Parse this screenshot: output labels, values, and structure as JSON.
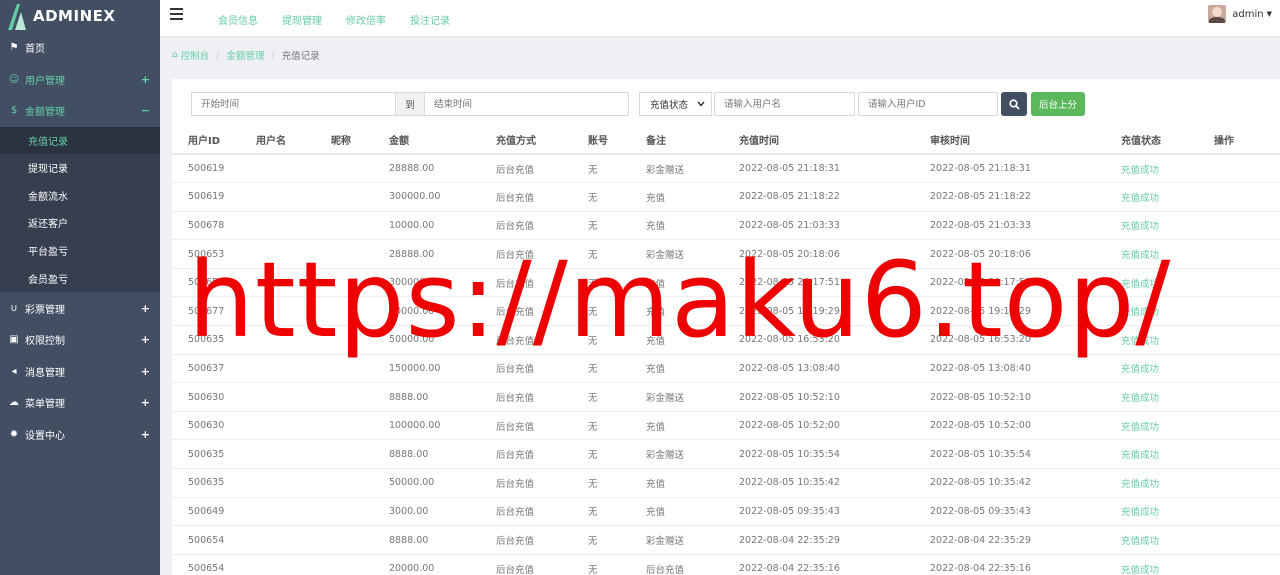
{
  "brand": {
    "name": "ADMINEX"
  },
  "sidebar": {
    "items": [
      {
        "key": "home",
        "label": "首页",
        "icon": "flag-icon",
        "toggle": ""
      },
      {
        "key": "users",
        "label": "用户管理",
        "icon": "smile-icon",
        "toggle": "+"
      },
      {
        "key": "finance",
        "label": "金额管理",
        "icon": "dollar-icon",
        "toggle": "−"
      }
    ],
    "subitems": [
      {
        "label": "充值记录",
        "active": true
      },
      {
        "label": "提现记录"
      },
      {
        "label": "金额流水"
      },
      {
        "label": "返还客户"
      },
      {
        "label": "平台盈亏"
      },
      {
        "label": "会员盈亏"
      }
    ],
    "items_after": [
      {
        "key": "lottery",
        "label": "彩票管理",
        "icon": "magnet-icon",
        "toggle": "+"
      },
      {
        "key": "permissions",
        "label": "权限控制",
        "icon": "lock-icon",
        "toggle": "+"
      },
      {
        "key": "messages",
        "label": "消息管理",
        "icon": "bullhorn-icon",
        "toggle": "+"
      },
      {
        "key": "menus",
        "label": "菜单管理",
        "icon": "cloud-icon",
        "toggle": "+"
      },
      {
        "key": "settings",
        "label": "设置中心",
        "icon": "gear-icon",
        "toggle": "+"
      }
    ]
  },
  "header": {
    "nav": [
      "会员信息",
      "提现管理",
      "修改倍率",
      "投注记录"
    ],
    "user": "admin"
  },
  "breadcrumb": {
    "home": "控制台",
    "parent": "金额管理",
    "current": "充值记录"
  },
  "filters": {
    "start_placeholder": "开始时间",
    "to_label": "到",
    "end_placeholder": "结束时间",
    "status_select": "充值状态",
    "username_placeholder": "请输入用户名",
    "userid_placeholder": "请输入用户ID",
    "add_button": "后台上分"
  },
  "table": {
    "columns": [
      "用户ID",
      "用户名",
      "昵称",
      "金额",
      "充值方式",
      "账号",
      "备注",
      "充值时间",
      "审核时间",
      "充值状态",
      "操作"
    ],
    "rows": [
      [
        "500619",
        "",
        "",
        "28888.00",
        "后台充值",
        "无",
        "彩金赠送",
        "2022-08-05 21:18:31",
        "2022-08-05 21:18:31",
        "充值成功",
        ""
      ],
      [
        "500619",
        "",
        "",
        "300000.00",
        "后台充值",
        "无",
        "充值",
        "2022-08-05 21:18:22",
        "2022-08-05 21:18:22",
        "充值成功",
        ""
      ],
      [
        "500678",
        "",
        "",
        "10000.00",
        "后台充值",
        "无",
        "充值",
        "2022-08-05 21:03:33",
        "2022-08-05 21:03:33",
        "充值成功",
        ""
      ],
      [
        "500653",
        "",
        "",
        "28888.00",
        "后台充值",
        "无",
        "彩金赠送",
        "2022-08-05 20:18:06",
        "2022-08-05 20:18:06",
        "充值成功",
        ""
      ],
      [
        "500653",
        "",
        "",
        "300000.00",
        "后台充值",
        "无",
        "充值",
        "2022-08-05 20:17:51",
        "2022-08-05 20:17:51",
        "充值成功",
        ""
      ],
      [
        "500677",
        "",
        "",
        "10000.00",
        "后台充值",
        "无",
        "充值",
        "2022-08-05 19:19:29",
        "2022-08-05 19:19:29",
        "充值成功",
        ""
      ],
      [
        "500635",
        "",
        "",
        "50000.00",
        "后台充值",
        "无",
        "充值",
        "2022-08-05 16:53:20",
        "2022-08-05 16:53:20",
        "充值成功",
        ""
      ],
      [
        "500637",
        "",
        "",
        "150000.00",
        "后台充值",
        "无",
        "充值",
        "2022-08-05 13:08:40",
        "2022-08-05 13:08:40",
        "充值成功",
        ""
      ],
      [
        "500630",
        "",
        "",
        "8888.00",
        "后台充值",
        "无",
        "彩金赠送",
        "2022-08-05 10:52:10",
        "2022-08-05 10:52:10",
        "充值成功",
        ""
      ],
      [
        "500630",
        "",
        "",
        "100000.00",
        "后台充值",
        "无",
        "充值",
        "2022-08-05 10:52:00",
        "2022-08-05 10:52:00",
        "充值成功",
        ""
      ],
      [
        "500635",
        "",
        "",
        "8888.00",
        "后台充值",
        "无",
        "彩金赠送",
        "2022-08-05 10:35:54",
        "2022-08-05 10:35:54",
        "充值成功",
        ""
      ],
      [
        "500635",
        "",
        "",
        "50000.00",
        "后台充值",
        "无",
        "充值",
        "2022-08-05 10:35:42",
        "2022-08-05 10:35:42",
        "充值成功",
        ""
      ],
      [
        "500649",
        "",
        "",
        "3000.00",
        "后台充值",
        "无",
        "充值",
        "2022-08-05 09:35:43",
        "2022-08-05 09:35:43",
        "充值成功",
        ""
      ],
      [
        "500654",
        "",
        "",
        "8888.00",
        "后台充值",
        "无",
        "彩金赠送",
        "2022-08-04 22:35:29",
        "2022-08-04 22:35:29",
        "充值成功",
        ""
      ],
      [
        "500654",
        "",
        "",
        "20000.00",
        "后台充值",
        "无",
        "后台充值",
        "2022-08-04 22:35:16",
        "2022-08-04 22:35:16",
        "充值成功",
        ""
      ]
    ]
  },
  "watermark": "https://maku6.top/",
  "colors": {
    "sidebar": "#424f63",
    "accent": "#65cea7",
    "success_button": "#5cb85c",
    "watermark": "#ee0000"
  }
}
